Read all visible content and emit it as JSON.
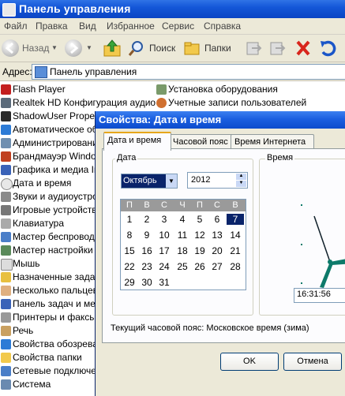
{
  "window": {
    "title": "Панель управления"
  },
  "menu": [
    "Файл",
    "Правка",
    "Вид",
    "Избранное",
    "Сервис",
    "Справка"
  ],
  "toolbar": {
    "back": "Назад",
    "search": "Поиск",
    "folders": "Папки"
  },
  "address": {
    "label": "Адрес:",
    "value": "Панель управления"
  },
  "list_left": [
    "Flash Player",
    "Realtek HD Конфигурация аудио",
    "ShadowUser Propertie",
    "Автоматическое обн",
    "Администрирование",
    "Брандмауэр Windows",
    "Графика и медиа Inte",
    "Дата и время",
    "Звуки и аудиоустрой",
    "Игровые устройства",
    "Клавиатура",
    "Мастер беспроводно",
    "Мастер настройки се",
    "Мышь",
    "Назначенные задани",
    "Несколько пальцев",
    "Панель задач и мен",
    "Принтеры и факсы",
    "Речь",
    "Свойства обозревате",
    "Свойства папки",
    "Сетевые подключен",
    "Система"
  ],
  "list_right": [
    "Установка оборудования",
    "Учетные записи пользователей"
  ],
  "dialog": {
    "title": "Свойства: Дата и время",
    "tabs": [
      "Дата и время",
      "Часовой пояс",
      "Время Интернета"
    ],
    "date_group": "Дата",
    "time_group": "Время",
    "month": "Октябрь",
    "year": "2012",
    "weekdays": [
      "П",
      "В",
      "С",
      "Ч",
      "П",
      "С",
      "В"
    ],
    "selected_day": "7",
    "time_value": "16:31:56",
    "timezone": "Текущий часовой пояс: Московское время (зима)",
    "ok": "OK",
    "cancel": "Отмена"
  },
  "colors": {
    "titlebar": "#0a44c4",
    "selection": "#0a246a",
    "clock_hands": "#0d7a6a"
  }
}
